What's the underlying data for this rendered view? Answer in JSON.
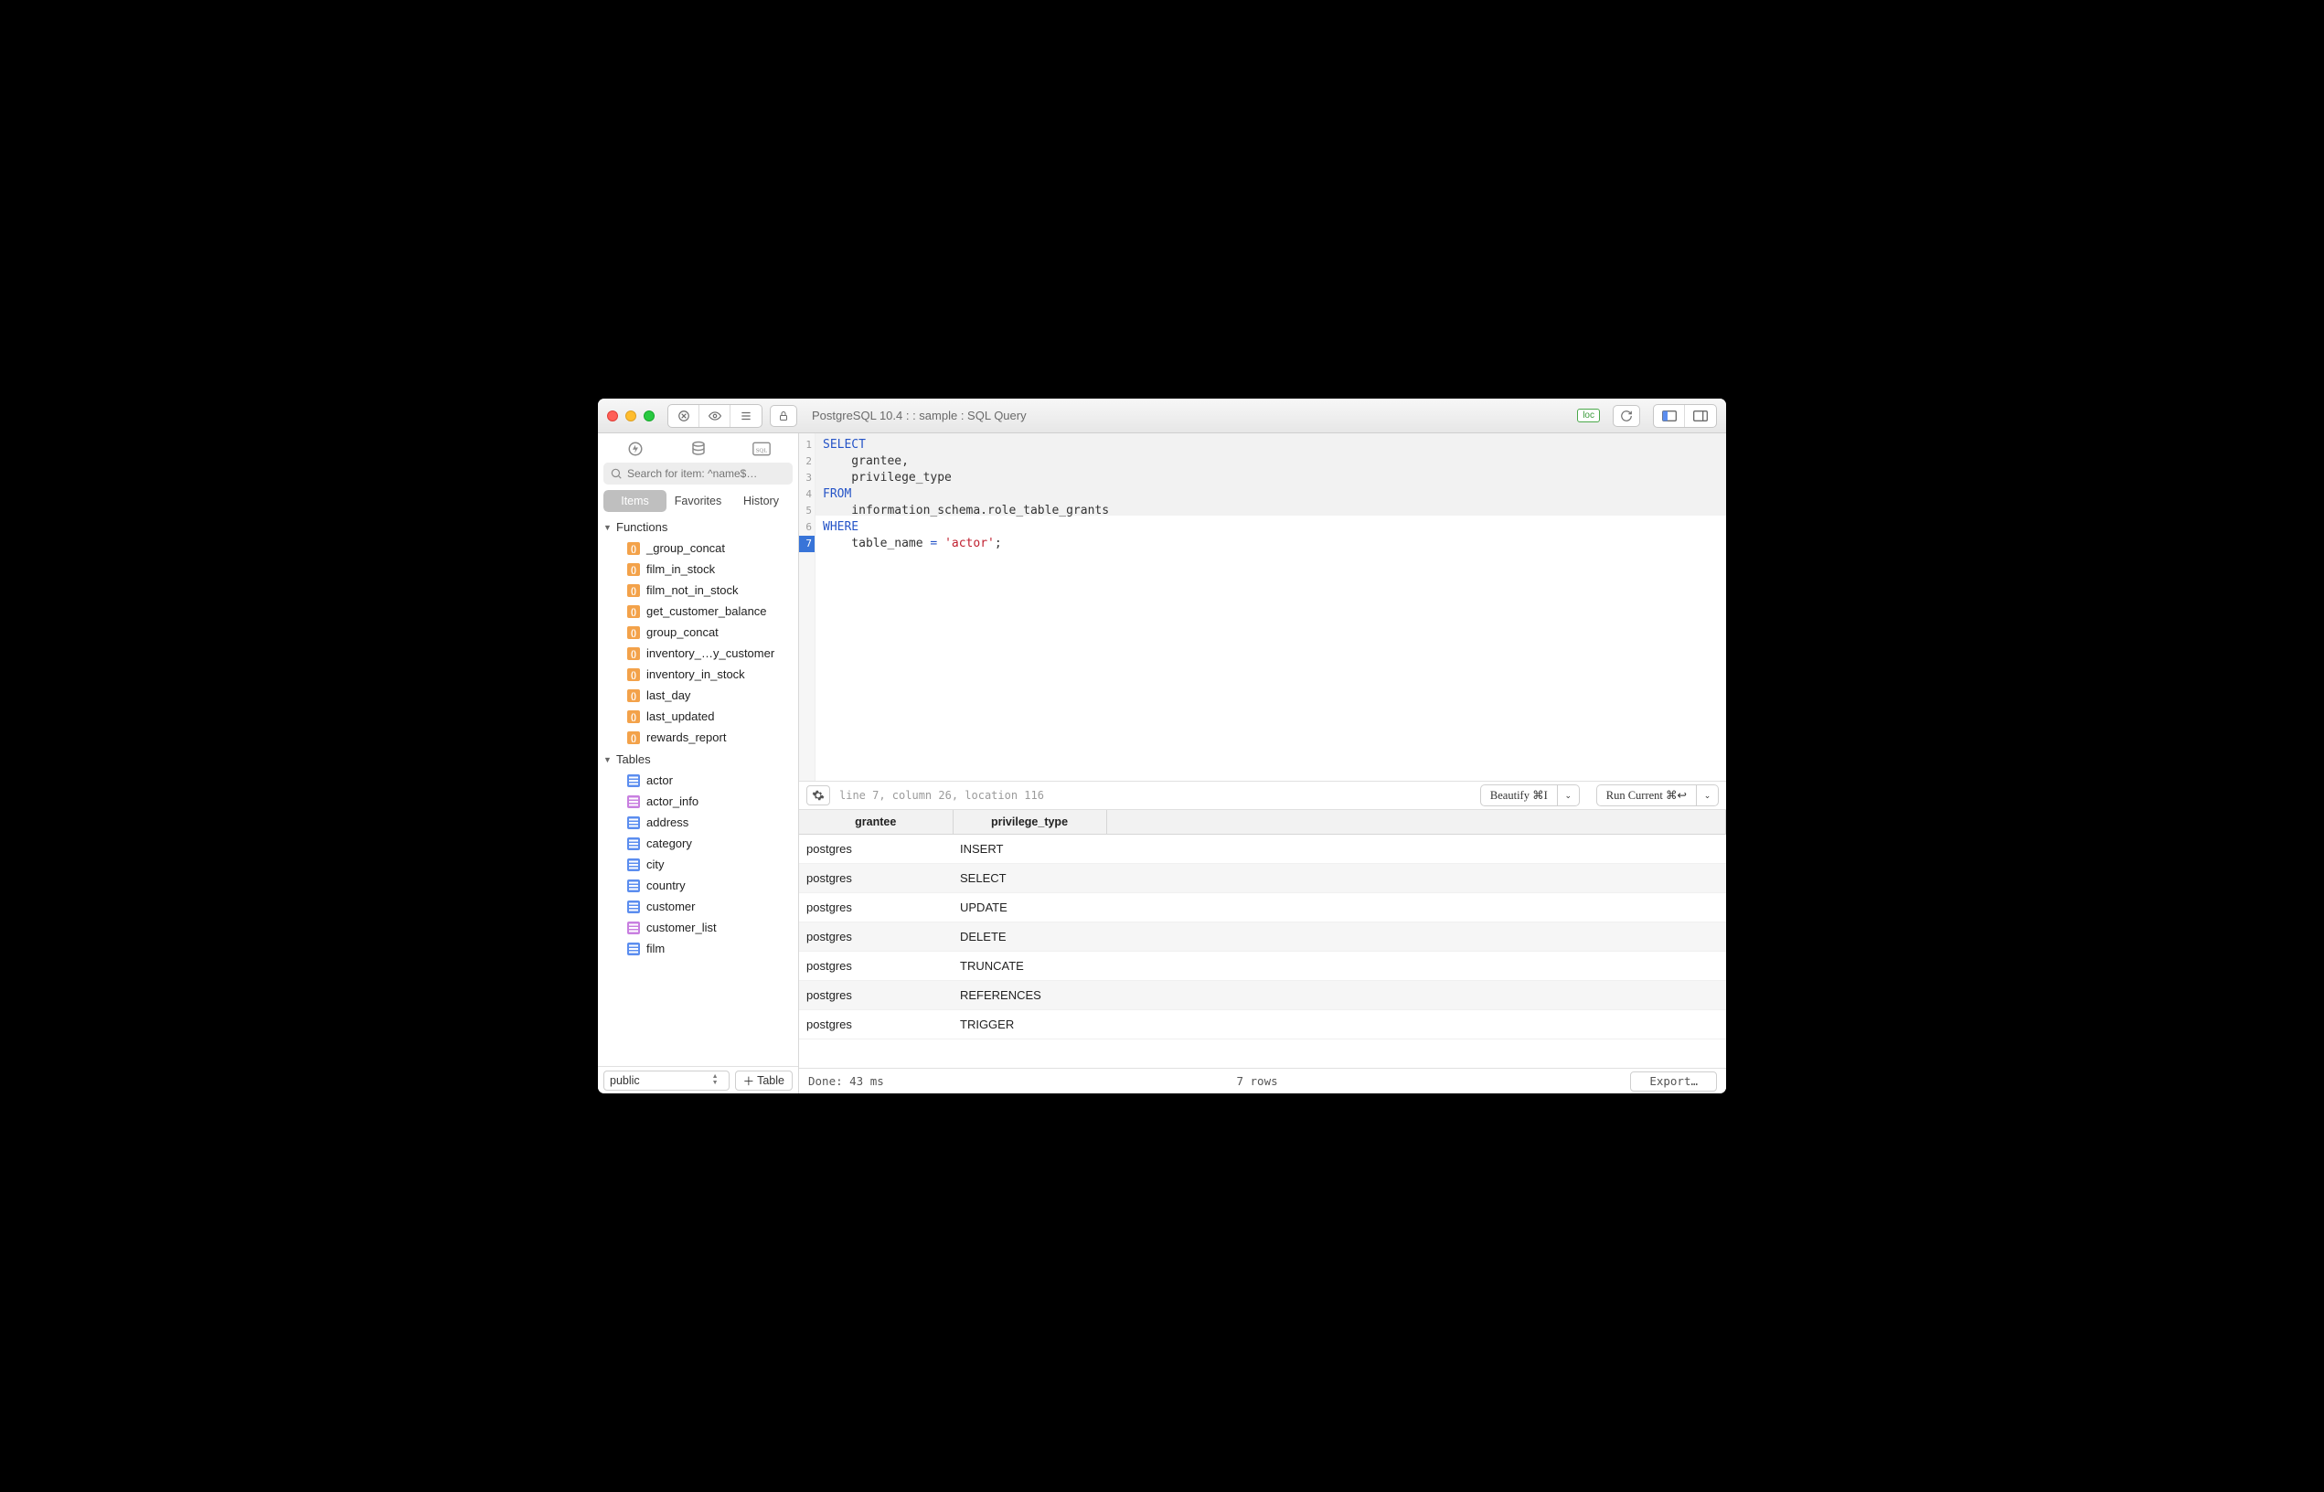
{
  "window": {
    "title": "PostgreSQL 10.4 :  : sample : SQL Query",
    "loc_badge": "loc"
  },
  "sidebar": {
    "search_placeholder": "Search for item: ^name$…",
    "tabs": {
      "items": "Items",
      "favorites": "Favorites",
      "history": "History"
    },
    "groups": [
      {
        "label": "Functions",
        "icon": "fn",
        "items": [
          "_group_concat",
          "film_in_stock",
          "film_not_in_stock",
          "get_customer_balance",
          "group_concat",
          "inventory_…y_customer",
          "inventory_in_stock",
          "last_day",
          "last_updated",
          "rewards_report"
        ]
      },
      {
        "label": "Tables",
        "icon": "tbl",
        "items": [
          {
            "name": "actor",
            "kind": "table"
          },
          {
            "name": "actor_info",
            "kind": "view"
          },
          {
            "name": "address",
            "kind": "table"
          },
          {
            "name": "category",
            "kind": "table"
          },
          {
            "name": "city",
            "kind": "table"
          },
          {
            "name": "country",
            "kind": "table"
          },
          {
            "name": "customer",
            "kind": "table"
          },
          {
            "name": "customer_list",
            "kind": "view"
          },
          {
            "name": "film",
            "kind": "table"
          }
        ]
      }
    ],
    "schema_popup": "public",
    "add_table": "Table"
  },
  "editor": {
    "lines": [
      [
        {
          "t": "SELECT",
          "c": "kw"
        }
      ],
      [
        {
          "t": "    grantee,",
          "c": ""
        }
      ],
      [
        {
          "t": "    privilege_type",
          "c": ""
        }
      ],
      [
        {
          "t": "FROM",
          "c": "kw"
        }
      ],
      [
        {
          "t": "    information_schema.role_table_grants",
          "c": ""
        }
      ],
      [
        {
          "t": "WHERE",
          "c": "kw"
        }
      ],
      [
        {
          "t": "    table_name ",
          "c": ""
        },
        {
          "t": "=",
          "c": "kw"
        },
        {
          "t": " ",
          "c": ""
        },
        {
          "t": "'actor'",
          "c": "str"
        },
        {
          "t": ";",
          "c": ""
        }
      ]
    ],
    "current_line": 7,
    "cursor_info": "line 7, column 26, location 116",
    "beautify": "Beautify ⌘I",
    "run": "Run Current ⌘↩"
  },
  "results": {
    "columns": [
      "grantee",
      "privilege_type"
    ],
    "rows": [
      [
        "postgres",
        "INSERT"
      ],
      [
        "postgres",
        "SELECT"
      ],
      [
        "postgres",
        "UPDATE"
      ],
      [
        "postgres",
        "DELETE"
      ],
      [
        "postgres",
        "TRUNCATE"
      ],
      [
        "postgres",
        "REFERENCES"
      ],
      [
        "postgres",
        "TRIGGER"
      ]
    ]
  },
  "status": {
    "done": "Done: 43 ms",
    "rows": "7 rows",
    "export": "Export…"
  }
}
